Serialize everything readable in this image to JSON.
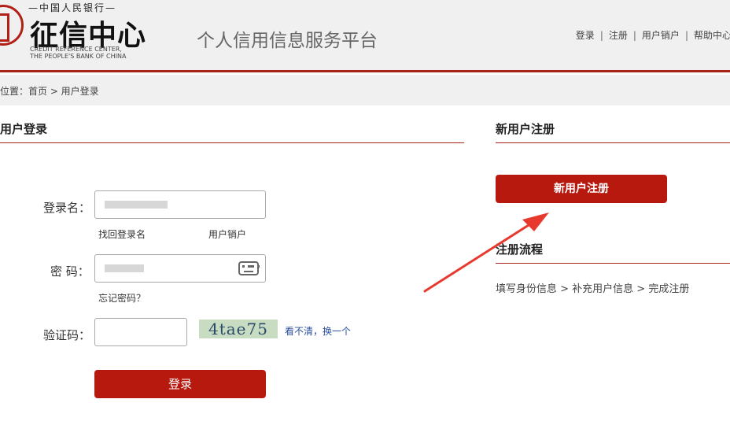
{
  "header": {
    "logo_top_text": "—中国人民银行—",
    "logo_name": "征信中心",
    "logo_en_line1": "CREDIT REFERENCE CENTER,",
    "logo_en_line2": "THE PEOPLE'S BANK OF CHINA",
    "site_title": "个人信用信息服务平台",
    "nav": [
      "登录",
      "注册",
      "用户销户",
      "帮助中心"
    ]
  },
  "breadcrumb": {
    "text": "位置：首页 > 用户登录"
  },
  "login": {
    "section_title": "用户登录",
    "username_label": "登录名：",
    "username_value": "",
    "retrieve_username_link": "找回登录名",
    "account_cancel_link": "用户销户",
    "password_label": "密 码：",
    "password_value": "",
    "forgot_password_link": "忘记密码？",
    "captcha_label": "验证码：",
    "captcha_value": "",
    "captcha_image_text": "4tae75",
    "captcha_refresh_link": "看不清，换一个",
    "login_button": "登录"
  },
  "register": {
    "section_title": "新用户注册",
    "register_button": "新用户注册",
    "flow_title": "注册流程",
    "flow_steps": "填写身份信息 > 补充用户信息 > 完成注册"
  },
  "colors": {
    "brand_red": "#b7190f",
    "rule_red": "#a8241b",
    "annotation_arrow": "#e8392f"
  },
  "icons": {
    "virtual_keyboard": "keyboard-icon",
    "annotation_arrow": "arrow-annotation"
  }
}
